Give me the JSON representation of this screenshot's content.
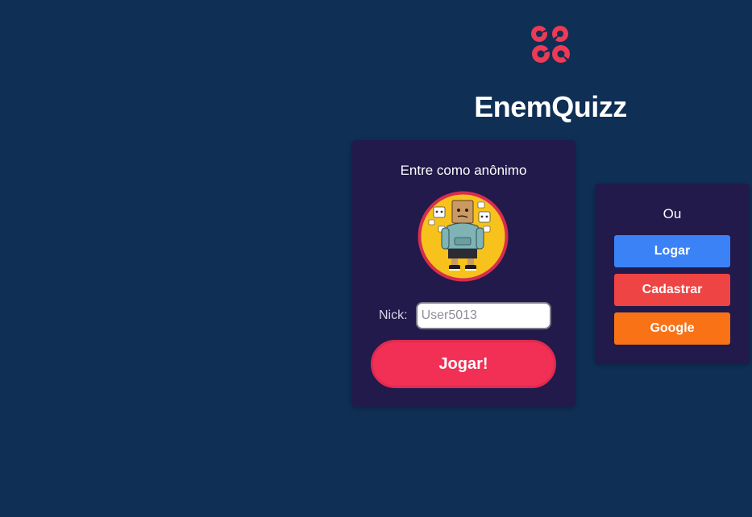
{
  "app": {
    "title": "EnemQuizz",
    "logo_icon": "quiz-logo-icon",
    "accent_color": "#f22f55",
    "background_color": "#0f2f55",
    "card_color": "#211a4b"
  },
  "anonymous": {
    "heading": "Entre como anônimo",
    "avatar_icon": "paper-bag-character-avatar",
    "nick_label": "Nick:",
    "nick_placeholder": "User5013",
    "nick_value": "",
    "play_label": "Jogar!"
  },
  "alternatives": {
    "or_label": "Ou",
    "login_label": "Logar",
    "login_color": "#3b82f6",
    "register_label": "Cadastrar",
    "register_color": "#ef4444",
    "google_label": "Google",
    "google_color": "#f97316"
  }
}
